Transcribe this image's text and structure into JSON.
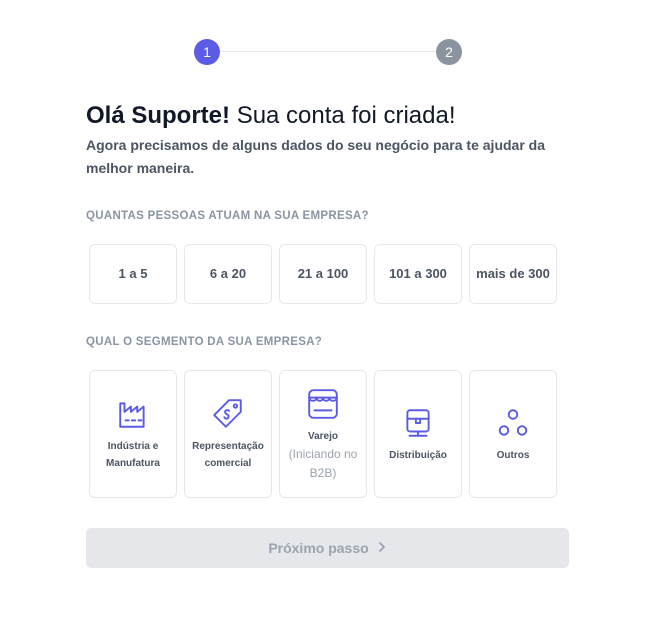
{
  "stepper": {
    "step1": "1",
    "step2": "2"
  },
  "header": {
    "greeting_bold": "Olá Suporte!",
    "greeting_rest": "Sua conta foi criada!",
    "subtitle": "Agora precisamos de alguns dados do seu negócio para te ajudar da melhor maneira."
  },
  "company_size": {
    "label": "QUANTAS PESSOAS ATUAM NA SUA EMPRESA?",
    "options": [
      "1 a 5",
      "6 a 20",
      "21 a 100",
      "101 a 300",
      "mais de 300"
    ]
  },
  "segment": {
    "label": "QUAL O SEGMENTO DA SUA EMPRESA?",
    "options": [
      {
        "label": "Indústria e Manufatura",
        "icon": "factory-icon"
      },
      {
        "label": "Representação comercial",
        "icon": "price-tag-icon"
      },
      {
        "label": "Varejo",
        "sub": "(Iniciando no B2B)",
        "icon": "storefront-icon"
      },
      {
        "label": "Distribuição",
        "icon": "distribution-icon"
      },
      {
        "label": "Outros",
        "icon": "three-circles-icon"
      }
    ]
  },
  "next_button": {
    "label": "Próximo passo"
  },
  "colors": {
    "accent": "#5b5be6",
    "inactive_step": "#8a939e",
    "icon": "#5b5be6"
  }
}
